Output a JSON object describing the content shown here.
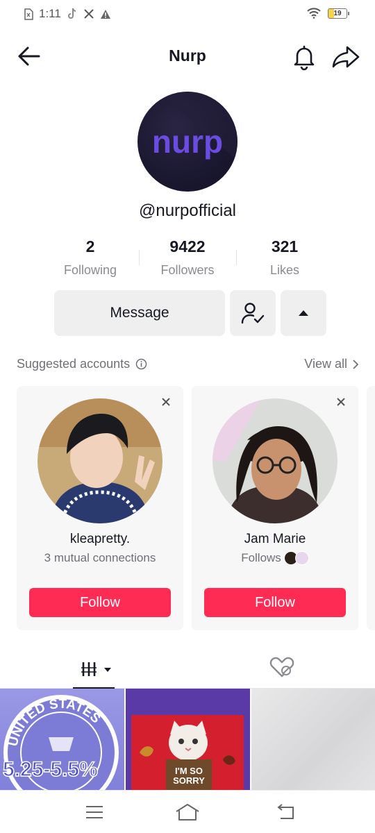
{
  "status_bar": {
    "time": "1:11",
    "battery": "19"
  },
  "header": {
    "title": "Nurp"
  },
  "profile": {
    "avatar_logo_text": "nurp",
    "handle": "@nurpofficial",
    "stats": [
      {
        "value": "2",
        "label": "Following"
      },
      {
        "value": "9422",
        "label": "Followers"
      },
      {
        "value": "321",
        "label": "Likes"
      }
    ],
    "message_label": "Message"
  },
  "suggested": {
    "title": "Suggested accounts",
    "view_all": "View all",
    "accounts": [
      {
        "name": "kleapretty.",
        "subtitle": "3 mutual connections",
        "follow_label": "Follow"
      },
      {
        "name": "Jam Marie",
        "subtitle": "Follows",
        "follow_label": "Follow"
      }
    ]
  },
  "videos": [
    {
      "caption": "5.25-5.5%",
      "arc_text": "UNITED STATES"
    },
    {
      "caption": "I'M SO SORRY"
    },
    {
      "caption": ""
    }
  ],
  "colors": {
    "accent": "#fe2c55",
    "text": "#161823",
    "muted": "#8a8b91"
  },
  "icons": [
    "back-arrow-icon",
    "bell-icon",
    "share-icon",
    "info-icon",
    "chevron-right-icon",
    "close-icon",
    "person-check-icon",
    "caret-up-icon",
    "grid-icon",
    "liked-hidden-icon"
  ]
}
